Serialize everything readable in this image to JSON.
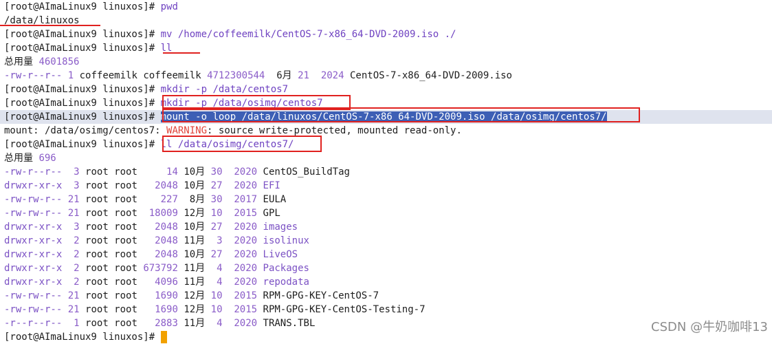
{
  "prompt": "[root@AImaLinux9 linuxos]#",
  "cmd1": "pwd",
  "out_pwd": "/data/linuxos",
  "cmd2": "mv /home/coffeemilk/CentOS-7-x86_64-DVD-2009.iso ./",
  "cmd3": "ll",
  "total_label": "总用量",
  "total1": "4601856",
  "iso_row": {
    "perm": "-rw-r--r--",
    "links": "1",
    "user": "coffeemilk",
    "group": "coffeemilk",
    "size": "4712300544",
    "month": "6月",
    "day": "21",
    "year": "2024",
    "name": "CentOS-7-x86_64-DVD-2009.iso"
  },
  "cmd4": "mkdir -p /data/centos7",
  "cmd5": "mkdir -p /data/osimg/centos7",
  "cmd6": "mount -o loop /data/linuxos/CentOS-7-x86_64-DVD-2009.iso /data/osimg/centos7/",
  "mount_msg": {
    "prefix": "mount: /data/osimg/centos7: ",
    "warning": "WARNING",
    "rest": ": source write-protected, mounted read-only."
  },
  "cmd7": "ll /data/osimg/centos7/",
  "total2": "696",
  "listing": [
    {
      "perm": "-rw-r--r--",
      "links": " 3",
      "owner": "root root",
      "size": "    14",
      "month": "10月",
      "day": "30",
      "year": "2020",
      "name": "CentOS_BuildTag",
      "is_dir": false
    },
    {
      "perm": "drwxr-xr-x",
      "links": " 3",
      "owner": "root root",
      "size": "  2048",
      "month": "10月",
      "day": "27",
      "year": "2020",
      "name": "EFI",
      "is_dir": true
    },
    {
      "perm": "-rw-rw-r--",
      "links": "21",
      "owner": "root root",
      "size": "   227",
      "month": " 8月",
      "day": "30",
      "year": "2017",
      "name": "EULA",
      "is_dir": false
    },
    {
      "perm": "-rw-rw-r--",
      "links": "21",
      "owner": "root root",
      "size": " 18009",
      "month": "12月",
      "day": "10",
      "year": "2015",
      "name": "GPL",
      "is_dir": false
    },
    {
      "perm": "drwxr-xr-x",
      "links": " 3",
      "owner": "root root",
      "size": "  2048",
      "month": "10月",
      "day": "27",
      "year": "2020",
      "name": "images",
      "is_dir": true
    },
    {
      "perm": "drwxr-xr-x",
      "links": " 2",
      "owner": "root root",
      "size": "  2048",
      "month": "11月",
      "day": " 3",
      "year": "2020",
      "name": "isolinux",
      "is_dir": true
    },
    {
      "perm": "drwxr-xr-x",
      "links": " 2",
      "owner": "root root",
      "size": "  2048",
      "month": "10月",
      "day": "27",
      "year": "2020",
      "name": "LiveOS",
      "is_dir": true
    },
    {
      "perm": "drwxr-xr-x",
      "links": " 2",
      "owner": "root root",
      "size": "673792",
      "month": "11月",
      "day": " 4",
      "year": "2020",
      "name": "Packages",
      "is_dir": true
    },
    {
      "perm": "drwxr-xr-x",
      "links": " 2",
      "owner": "root root",
      "size": "  4096",
      "month": "11月",
      "day": " 4",
      "year": "2020",
      "name": "repodata",
      "is_dir": true
    },
    {
      "perm": "-rw-rw-r--",
      "links": "21",
      "owner": "root root",
      "size": "  1690",
      "month": "12月",
      "day": "10",
      "year": "2015",
      "name": "RPM-GPG-KEY-CentOS-7",
      "is_dir": false
    },
    {
      "perm": "-rw-rw-r--",
      "links": "21",
      "owner": "root root",
      "size": "  1690",
      "month": "12月",
      "day": "10",
      "year": "2015",
      "name": "RPM-GPG-KEY-CentOS-Testing-7",
      "is_dir": false
    },
    {
      "perm": "-r--r--r--",
      "links": " 1",
      "owner": "root root",
      "size": "  2883",
      "month": "11月",
      "day": " 4",
      "year": "2020",
      "name": "TRANS.TBL",
      "is_dir": false
    }
  ],
  "watermark": "CSDN @牛奶咖啡13",
  "colors": {
    "annotation": "#e0211f",
    "cursor": "#f2a100",
    "selection": "#3d5fb5"
  }
}
